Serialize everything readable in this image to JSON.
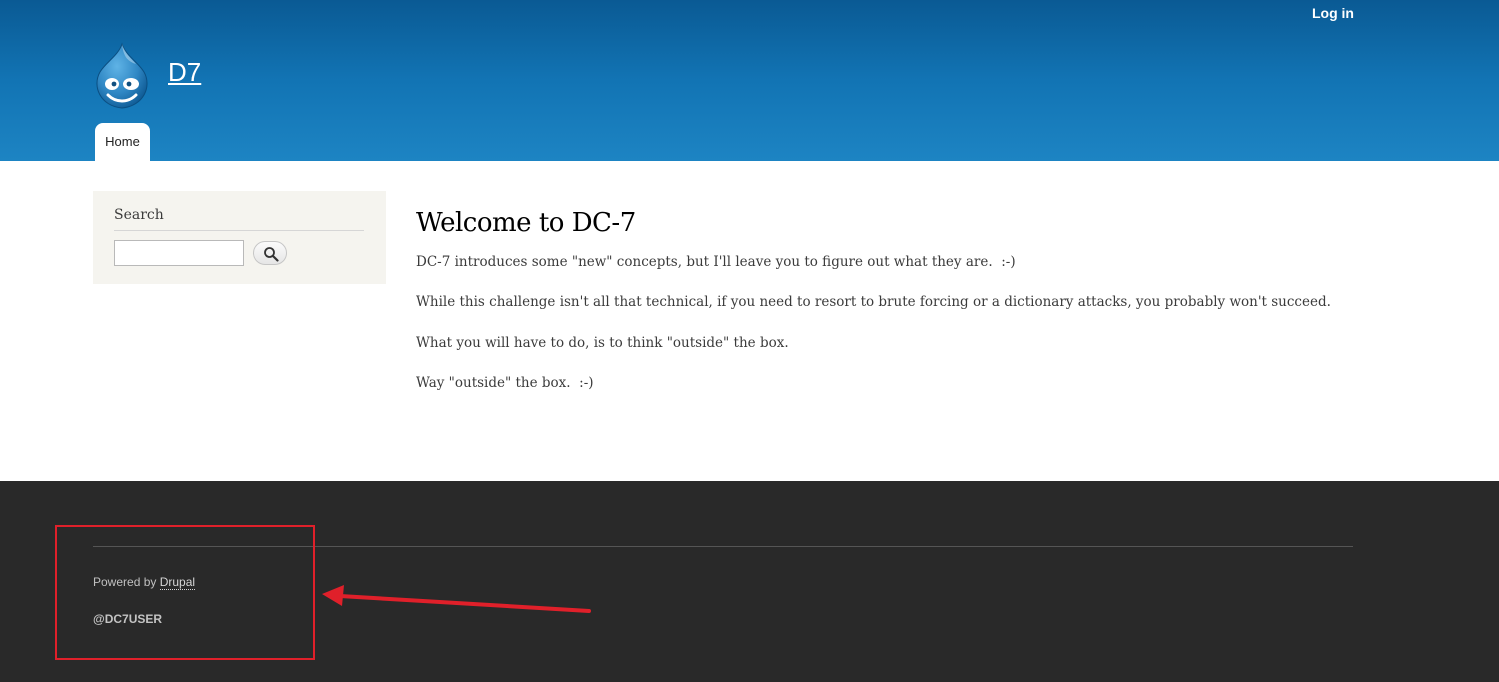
{
  "header": {
    "login_label": "Log in",
    "site_name": "D7",
    "logo_icon": "drupal-drop-icon",
    "nav": {
      "tabs": [
        {
          "label": "Home",
          "active": true
        }
      ]
    },
    "colors": {
      "gradient_top": "#0a5a94",
      "gradient_bottom": "#1d84c3"
    }
  },
  "sidebar": {
    "search": {
      "title": "Search",
      "input_value": "",
      "button_icon": "search-icon"
    }
  },
  "main": {
    "title": "Welcome to DC-7",
    "paragraphs": [
      "DC-7 introduces some \"new\" concepts, but I'll leave you to figure out what they are.  :-)",
      "While this challenge isn't all that technical, if you need to resort to brute forcing or a dictionary attacks, you probably won't succeed.",
      "What you will have to do, is to think \"outside\" the box.",
      "Way \"outside\" the box.  :-)"
    ]
  },
  "footer": {
    "powered_by_prefix": "Powered by ",
    "drupal_link": "Drupal",
    "user_handle": "@DC7USER",
    "annotation": {
      "color": "#e0202a",
      "type": "red-box-with-arrow"
    },
    "background": "#292929"
  }
}
